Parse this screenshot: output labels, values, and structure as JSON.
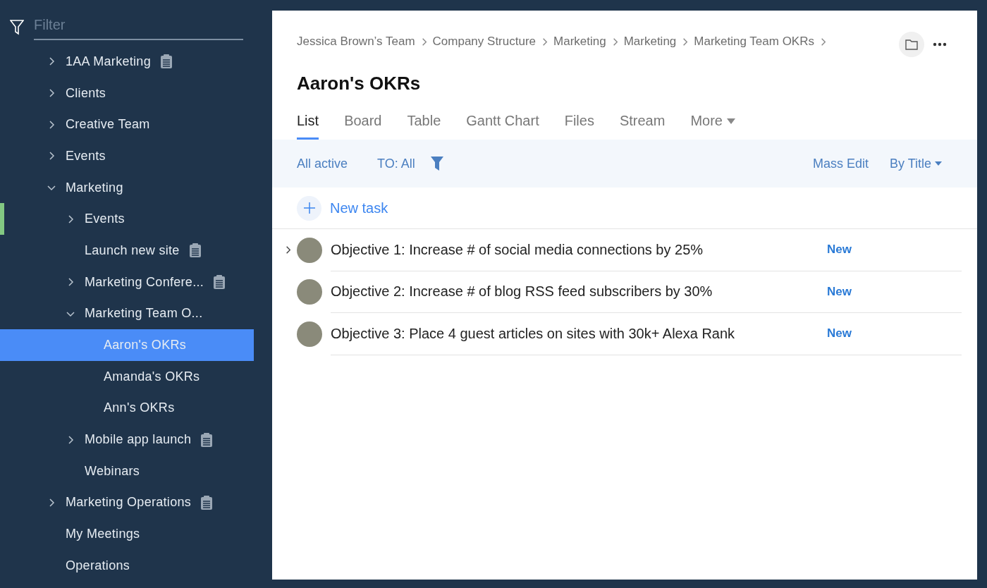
{
  "sidebar": {
    "filter": {
      "placeholder": "Filter"
    },
    "items": [
      {
        "label": "1AA Marketing",
        "note": true,
        "expanded": false,
        "selected": false
      },
      {
        "label": "Clients",
        "note": false,
        "expanded": false,
        "selected": false
      },
      {
        "label": "Creative Team",
        "note": false,
        "expanded": false,
        "selected": false
      },
      {
        "label": "Events",
        "note": false,
        "expanded": false,
        "selected": false
      },
      {
        "label": "Marketing",
        "note": false,
        "expanded": true,
        "selected": false,
        "children": [
          {
            "label": "Events",
            "note": false,
            "expanded": false,
            "selected": false,
            "flagged": true
          },
          {
            "label": "Launch new site",
            "note": true,
            "selected": false
          },
          {
            "label": "Marketing Confere...",
            "note": true,
            "expanded": false,
            "selected": false
          },
          {
            "label": "Marketing Team O...",
            "note": false,
            "expanded": true,
            "selected": false,
            "children": [
              {
                "label": "Aaron's OKRs",
                "note": false,
                "selected": true
              },
              {
                "label": "Amanda's OKRs",
                "note": false,
                "selected": false
              },
              {
                "label": "Ann's OKRs",
                "note": false,
                "selected": false
              }
            ]
          },
          {
            "label": "Mobile app launch",
            "note": true,
            "expanded": false,
            "selected": false
          },
          {
            "label": "Webinars",
            "note": false,
            "selected": false
          }
        ]
      },
      {
        "label": "Marketing Operations",
        "note": true,
        "expanded": false,
        "selected": false
      },
      {
        "label": "My Meetings",
        "note": false,
        "selected": false
      },
      {
        "label": "Operations",
        "note": false,
        "selected": false
      }
    ]
  },
  "breadcrumbs": [
    "Jessica Brown’s Team",
    "Company Structure",
    "Marketing",
    "Marketing",
    "Marketing Team OKRs"
  ],
  "title": "Aaron's OKRs",
  "tabs": [
    {
      "label": "List",
      "selected": true
    },
    {
      "label": "Board",
      "selected": false
    },
    {
      "label": "Table",
      "selected": false
    },
    {
      "label": "Gantt Chart",
      "selected": false
    },
    {
      "label": "Files",
      "selected": false
    },
    {
      "label": "Stream",
      "selected": false
    },
    {
      "label": "More",
      "selected": false
    }
  ],
  "toolbar": {
    "status_filter": "All active",
    "assignee_filter": "TO: All",
    "mass_edit": "Mass Edit",
    "sort": "By Title"
  },
  "new_task": "New task",
  "tasks": [
    {
      "title": "Objective 1: Increase # of social media connections by 25%",
      "status": "New",
      "expandable": true
    },
    {
      "title": "Objective 2: Increase # of blog RSS feed subscribers by 30%",
      "status": "New",
      "expandable": false
    },
    {
      "title": "Objective 3: Place 4 guest articles on sites with 30k+ Alexa Rank",
      "status": "New",
      "expandable": false
    }
  ]
}
